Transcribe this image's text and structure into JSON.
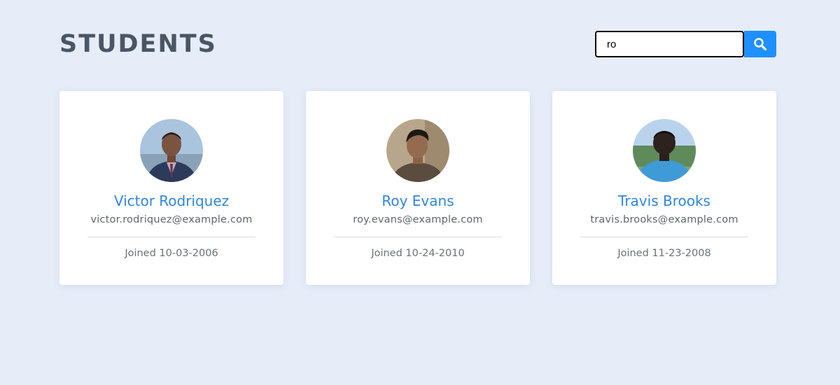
{
  "header": {
    "title": "STUDENTS"
  },
  "search": {
    "value": "ro",
    "button_icon": "search-icon"
  },
  "colors": {
    "background": "#e6edf9",
    "title": "#4a5566",
    "accent": "#1e90ff",
    "name": "#2f86e0",
    "card": "#ffffff"
  },
  "students": [
    {
      "name": "Victor Rodriquez",
      "email": "victor.rodriquez@example.com",
      "joined": "Joined 10-03-2006"
    },
    {
      "name": "Roy Evans",
      "email": "roy.evans@example.com",
      "joined": "Joined 10-24-2010"
    },
    {
      "name": "Travis Brooks",
      "email": "travis.brooks@example.com",
      "joined": "Joined 11-23-2008"
    }
  ]
}
